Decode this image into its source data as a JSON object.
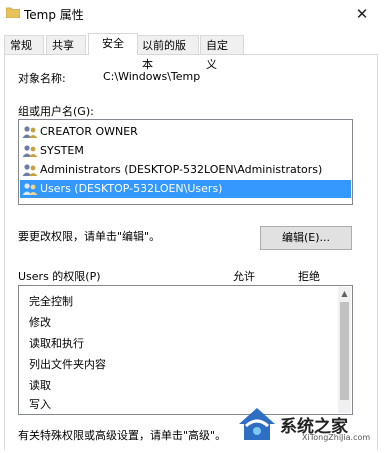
{
  "window": {
    "title": "Temp 属性",
    "close_glyph": "✕"
  },
  "tabs": [
    {
      "label": "常规"
    },
    {
      "label": "共享"
    },
    {
      "label": "安全",
      "active": true
    },
    {
      "label": "以前的版本"
    },
    {
      "label": "自定义"
    }
  ],
  "object": {
    "label": "对象名称:",
    "value": "C:\\Windows\\Temp"
  },
  "groups": {
    "label": "组或用户名(G):",
    "items": [
      {
        "name": "CREATOR OWNER"
      },
      {
        "name": "SYSTEM"
      },
      {
        "name": "Administrators (DESKTOP-532LOEN\\Administrators)"
      },
      {
        "name": "Users (DESKTOP-532LOEN\\Users)",
        "selected": true
      }
    ]
  },
  "edit": {
    "hint": "要更改权限，请单击\"编辑\"。",
    "button_label": "编辑(E)..."
  },
  "permissions": {
    "label": "Users 的权限(P)",
    "allow_header": "允许",
    "deny_header": "拒绝",
    "items": [
      {
        "name": "完全控制"
      },
      {
        "name": "修改"
      },
      {
        "name": "读取和执行"
      },
      {
        "name": "列出文件夹内容"
      },
      {
        "name": "读取"
      },
      {
        "name": "写入"
      }
    ]
  },
  "advanced": {
    "hint": "有关特殊权限或高级设置，请单击\"高级\"。"
  },
  "watermark": {
    "text": "系统之家",
    "sub": "XiTongZhiJia.com"
  },
  "colors": {
    "selection": "#3399ff",
    "folder": "#e8c25a",
    "border": "#828790"
  }
}
